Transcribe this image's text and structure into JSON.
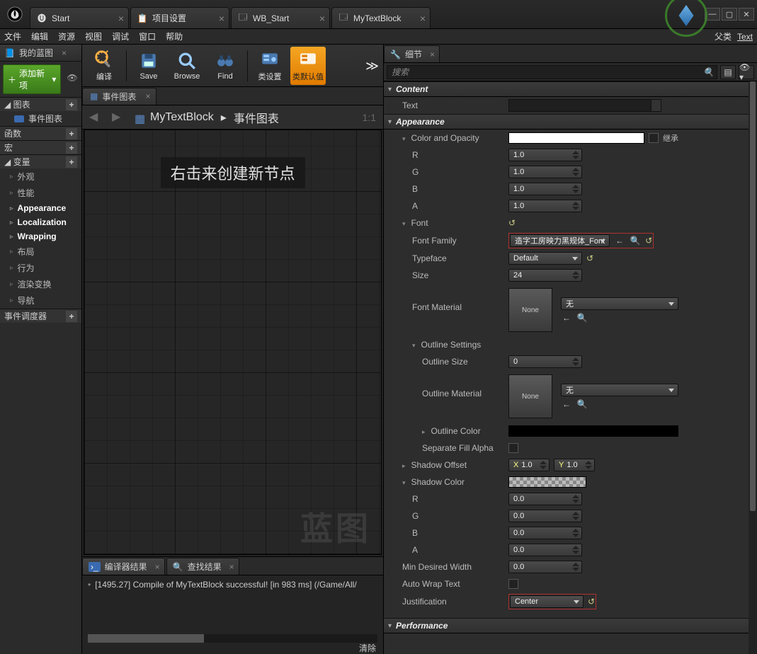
{
  "titlebar": {
    "tabs": [
      {
        "label": "Start",
        "icon": "ue-logo"
      },
      {
        "label": "项目设置",
        "icon": "clipboard"
      },
      {
        "label": "WB_Start",
        "icon": "widget"
      },
      {
        "label": "MyTextBlock",
        "icon": "widget"
      }
    ]
  },
  "menubar": {
    "items": [
      "文件",
      "编辑",
      "资源",
      "视图",
      "调试",
      "窗口",
      "帮助"
    ],
    "parent_label": "父类",
    "parent_value": "Text"
  },
  "leftPanel": {
    "myBlueprint": "我的蓝图",
    "addNew": "添加新项",
    "categories": {
      "graphs": {
        "label": "图表",
        "items": [
          {
            "label": "事件图表"
          }
        ]
      },
      "functions": {
        "label": "函数"
      },
      "macros": {
        "label": "宏"
      },
      "variables": {
        "label": "变量",
        "items": [
          "外观",
          "性能",
          "Appearance",
          "Localization",
          "Wrapping",
          "布局",
          "行为",
          "渲染变换",
          "导航"
        ],
        "bold": [
          "Appearance",
          "Localization",
          "Wrapping"
        ]
      },
      "dispatchers": {
        "label": "事件调度器"
      }
    }
  },
  "toolbar": {
    "compile": "编译",
    "save": "Save",
    "browse": "Browse",
    "find": "Find",
    "classSettings": "类设置",
    "classDefaults": "类默认值"
  },
  "graph": {
    "tab": "事件图表",
    "crumb_root": "MyTextBlock",
    "crumb_leaf": "事件图表",
    "zoom": "1:1",
    "hint": "右击来创建新节点",
    "watermark": "蓝图"
  },
  "bottom": {
    "compilerResults": "编译器结果",
    "findResults": "查找结果",
    "logEntry": "[1495.27] Compile of MyTextBlock successful! [in 983 ms] (/Game/All/",
    "clear": "清除"
  },
  "details": {
    "tab": "细节",
    "searchPlaceholder": "搜索",
    "sections": {
      "content": {
        "title": "Content",
        "text": {
          "label": "Text",
          "value": ""
        }
      },
      "appearance": {
        "title": "Appearance",
        "colorOpacity": {
          "label": "Color and Opacity",
          "inherit": "继承",
          "r": "1.0",
          "g": "1.0",
          "b": "1.0",
          "a": "1.0"
        },
        "font": {
          "label": "Font",
          "family": {
            "label": "Font Family",
            "value": "造字工房映力黑规体_Font"
          },
          "typeface": {
            "label": "Typeface",
            "value": "Default"
          },
          "size": {
            "label": "Size",
            "value": "24"
          },
          "material": {
            "label": "Font Material",
            "thumb": "None",
            "value": "无"
          },
          "outline": {
            "label": "Outline Settings",
            "size": {
              "label": "Outline Size",
              "value": "0"
            },
            "material": {
              "label": "Outline Material",
              "thumb": "None",
              "value": "无"
            },
            "color": {
              "label": "Outline Color"
            },
            "separateFillAlpha": {
              "label": "Separate Fill Alpha"
            }
          }
        },
        "shadowOffset": {
          "label": "Shadow Offset",
          "x": "1.0",
          "y": "1.0"
        },
        "shadowColor": {
          "label": "Shadow Color",
          "r": "0.0",
          "g": "0.0",
          "b": "0.0",
          "a": "0.0"
        },
        "minDesiredWidth": {
          "label": "Min Desired Width",
          "value": "0.0"
        },
        "autoWrap": {
          "label": "Auto Wrap Text"
        },
        "justification": {
          "label": "Justification",
          "value": "Center"
        }
      },
      "performance": {
        "title": "Performance"
      }
    }
  }
}
